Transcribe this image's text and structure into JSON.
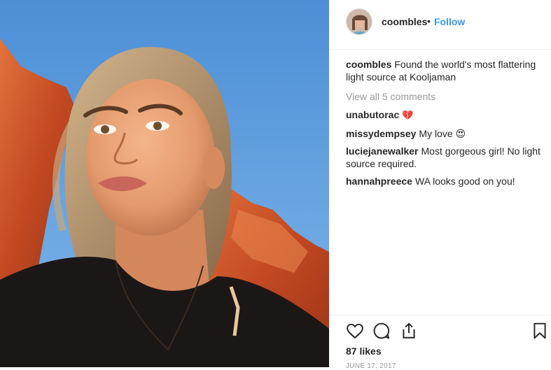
{
  "post": {
    "username": "coombles",
    "separator": "•",
    "follow_label": "Follow",
    "caption": "Found the world's most flattering light source at Kooljaman",
    "view_all_comments": "View all 5 comments",
    "comments": [
      {
        "user": "unabutorac",
        "text": "💔"
      },
      {
        "user": "missydempsey",
        "text": "My love 😍"
      },
      {
        "user": "luciejanewalker",
        "text": "Most gorgeous girl! No light source required."
      },
      {
        "user": "hannahpreece",
        "text": "WA looks good on you!"
      }
    ],
    "likes": "87 likes",
    "date": "JUNE 17, 2017"
  },
  "icons": {
    "like": "heart-icon",
    "comment": "comment-icon",
    "share": "share-icon",
    "save": "bookmark-icon"
  },
  "colors": {
    "link_blue": "#3897f0",
    "muted_gray": "#999999",
    "text": "#262626",
    "sky": "#5f9ddb",
    "rock": "#d2562a"
  }
}
